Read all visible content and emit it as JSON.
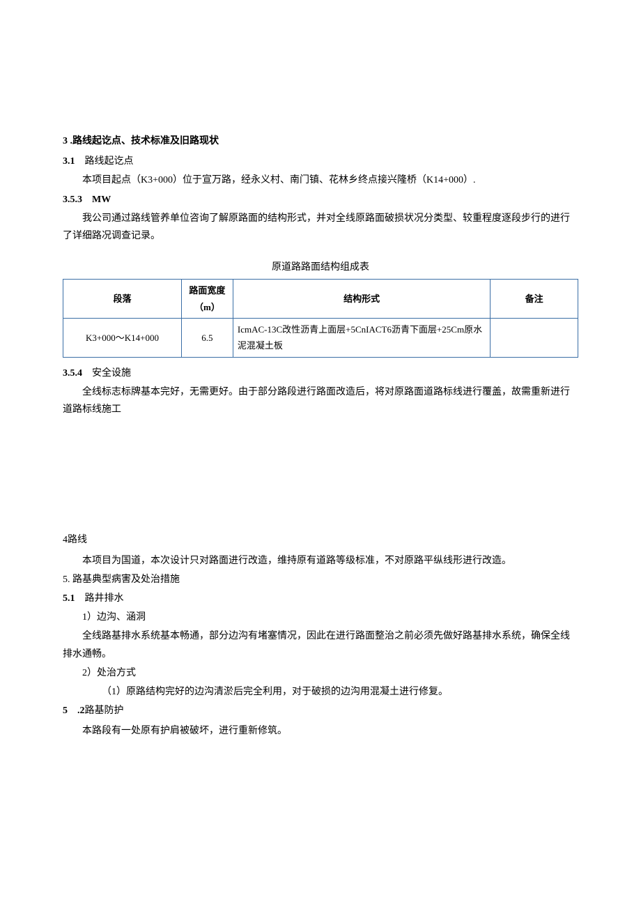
{
  "s3": {
    "num": "3",
    "heading": ".路线起讫点、技术标准及旧路现状",
    "s3_1": {
      "num": "3.1",
      "title": "路线起讫点",
      "p1": "本项目起点（K3+000）位于宣万路，经永义村、南门镇、花林乡终点接兴隆桥（K14+000）."
    },
    "s3_5_3": {
      "num": "3.5.3",
      "title": "MW",
      "p1": "我公司通过路线管养单位咨询了解原路面的结构形式，并对全线原路面破损状况分类型、较重程度逐段步行的进行了详细路况调查记录。"
    },
    "table": {
      "title": "原道路路面结构组成表",
      "headers": {
        "seg": "段落",
        "width": "路面宽度（m）",
        "struct": "结构形式",
        "note": "备注"
      },
      "row1": {
        "seg": "K3+000～K14+000",
        "width": "6.5",
        "struct": "IcmAC-13C改性沥青上面层+5CnIACT6沥青下面层+25Cm原水泥混凝土板",
        "note": ""
      }
    },
    "s3_5_4": {
      "num": "3.5.4",
      "title": "安全设施",
      "p1": "全线标志标牌基本完好，无需更好。由于部分路段进行路面改造后，将对原路面道路标线进行覆盖，故需重新进行道路标线施工"
    }
  },
  "s4": {
    "num": "4",
    "heading": "路线",
    "p1": "本项目为国道，本次设计只对路面进行改造，维持原有道路等级标准，不对原路平纵线形进行改造。"
  },
  "s5": {
    "num": "5.",
    "heading": "路基典型病害及处治措施",
    "s5_1": {
      "num": "5.1",
      "title": "路井排水",
      "item1": "1）边沟、涵洞",
      "p1": "全线路基排水系统基本畅通，部分边沟有堵塞情况，因此在进行路面整治之前必须先做好路基排水系统，确保全线排水通畅。",
      "item2": "2）处治方式",
      "sub1": "（1）原路结构完好的边沟清淤后完全利用，对于破损的边沟用混凝土进行修复。"
    },
    "s5_2": {
      "num": "5",
      "numtail": ".2",
      "title": "路基防护",
      "p1": "本路段有一处原有护肩被破坏，进行重新修筑。"
    }
  }
}
